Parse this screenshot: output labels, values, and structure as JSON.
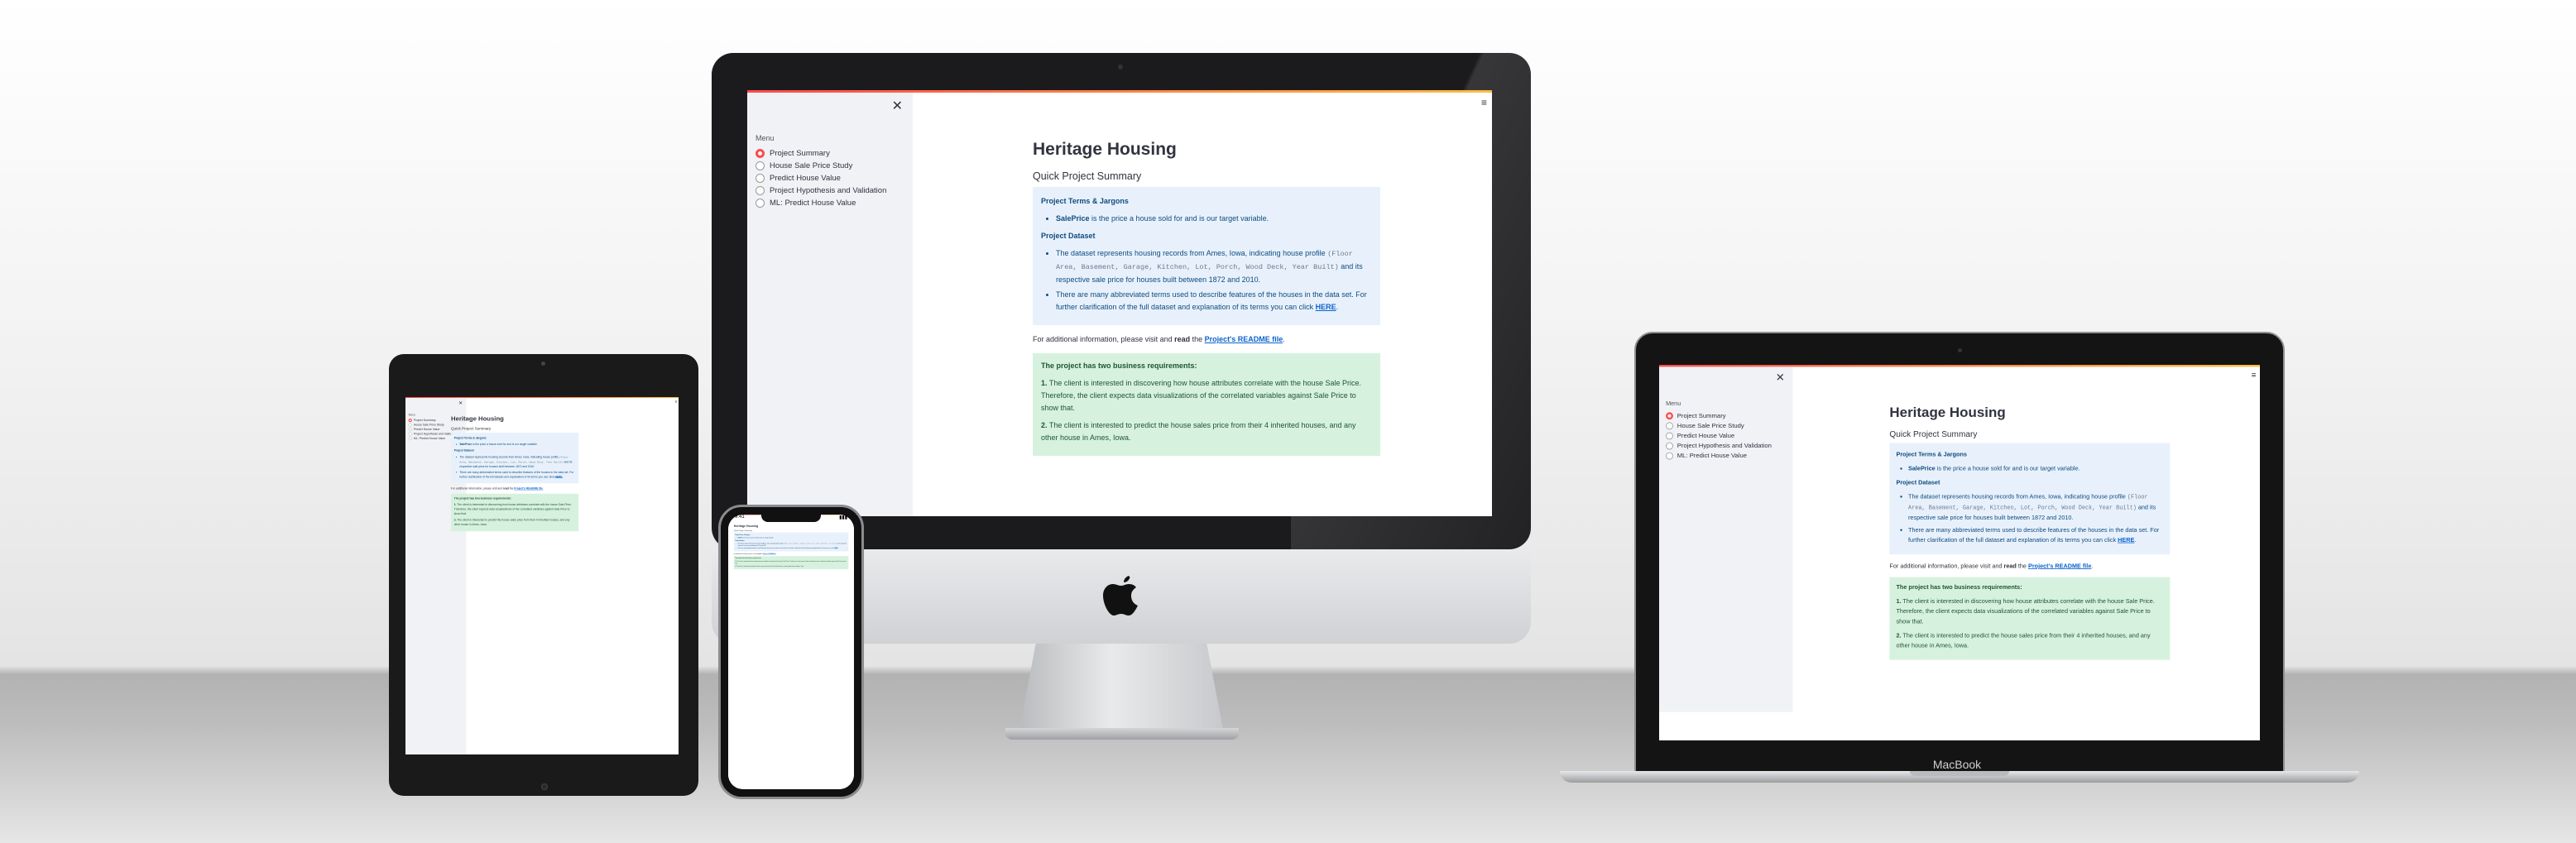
{
  "app": {
    "menu_label": "Menu",
    "close_glyph": "✕",
    "hamburger_glyph": "≡",
    "nav_items": [
      {
        "label": "Project Summary",
        "selected": true
      },
      {
        "label": "House Sale Price Study",
        "selected": false
      },
      {
        "label": "Predict House Value",
        "selected": false
      },
      {
        "label": "Project Hypothesis and Validation",
        "selected": false
      },
      {
        "label": "ML: Predict House Value",
        "selected": false
      }
    ],
    "title": "Heritage Housing",
    "subtitle": "Quick Project Summary",
    "terms_header": "Project Terms & Jargons",
    "saleprice_term": "SalePrice",
    "saleprice_def": " is the price a house sold for and is our target variable.",
    "dataset_header": "Project Dataset",
    "dataset_bullet1_text": "The dataset represents housing records from Ames, Iowa, indicating house profile",
    "dataset_bullet1_code": "(Floor Area, Basement, Garage, Kitchen, Lot, Porch, Wood Deck, Year Built)",
    "dataset_bullet1_tail": " and its respective sale price for houses built between 1872 and 2010.",
    "dataset_bullet2_text": "There are many abbreviated terms used to describe features of the houses in the data set. For further clarification of the full dataset and explanation of its terms you can click ",
    "here_link": "HERE",
    "additional_pre": "For additional information, please visit and ",
    "additional_bold": "read",
    "additional_mid": " the ",
    "readme_link": "Project's README file",
    "business_header": "The project has two business requirements:",
    "req1_num": "1.",
    "req1_text": " The client is interested in discovering how house attributes correlate with the house Sale Price. Therefore, the client expects data visualizations of the correlated variables against Sale Price to show that.",
    "req2_num": "2.",
    "req2_text": " The client is interested to predict the house sales price from their 4 inherited houses, and any other house in Ames, Iowa."
  },
  "phone_status": {
    "time": "9:41",
    "signal": "▮▮▮"
  },
  "laptop_brand": "MacBook",
  "colors": {
    "accent": "#ff4b4b",
    "info_bg": "#e8f1fb",
    "success_bg": "#d7f1df",
    "sidebar_bg": "#f0f2f6"
  }
}
